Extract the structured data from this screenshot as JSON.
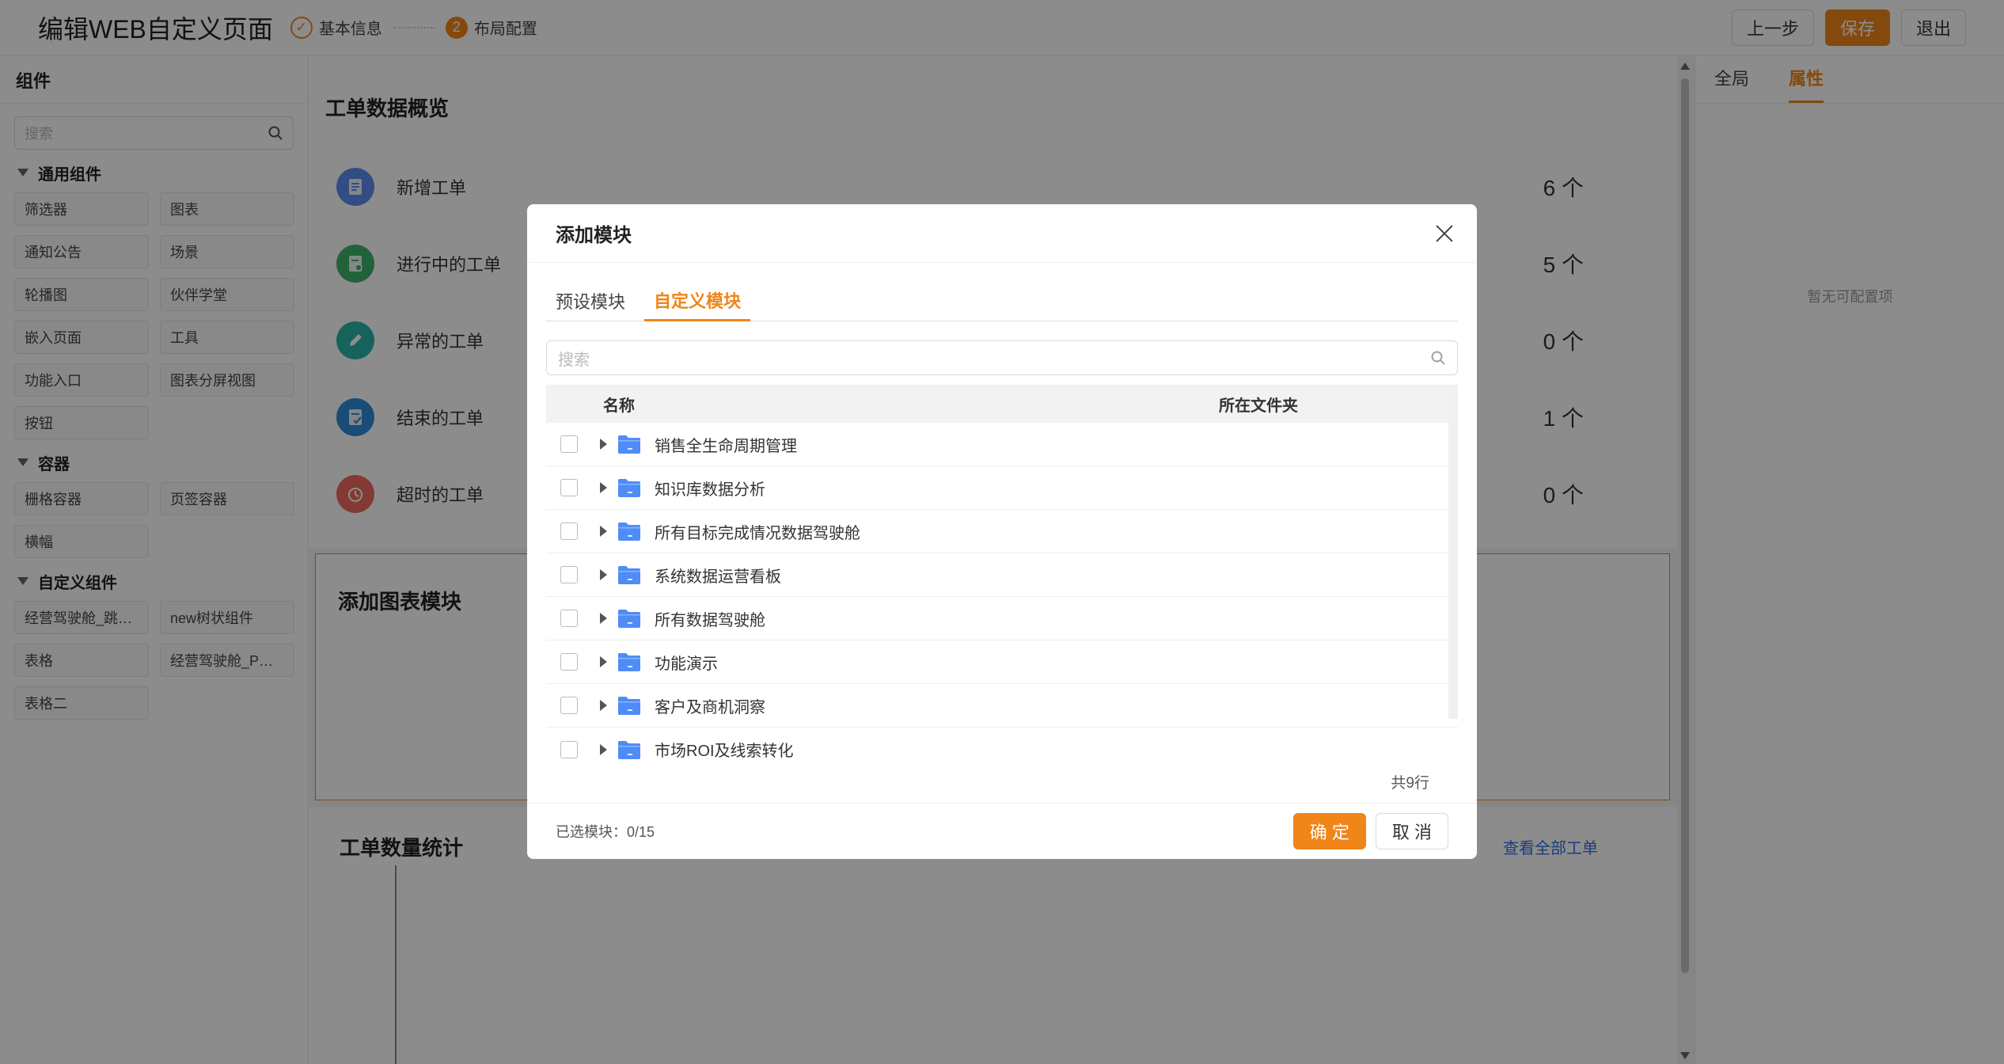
{
  "header": {
    "title": "编辑WEB自定义页面",
    "steps": [
      {
        "label": "基本信息",
        "marker": "✓"
      },
      {
        "label": "布局配置",
        "marker": "2"
      }
    ],
    "buttons": {
      "prev": "上一步",
      "save": "保存",
      "exit": "退出"
    }
  },
  "left_panel": {
    "title": "组件",
    "search_placeholder": "搜索",
    "groups": [
      {
        "title": "通用组件",
        "items": [
          "筛选器",
          "图表",
          "通知公告",
          "场景",
          "轮播图",
          "伙伴学堂",
          "嵌入页面",
          "工具",
          "功能入口",
          "图表分屏视图",
          "按钮"
        ]
      },
      {
        "title": "容器",
        "items": [
          "栅格容器",
          "页签容器",
          "横幅"
        ]
      },
      {
        "title": "自定义组件",
        "items": [
          "经营驾驶舱_跳…",
          "new树状组件",
          "表格",
          "经营驾驶舱_P…",
          "表格二"
        ]
      }
    ]
  },
  "canvas": {
    "overview_title": "工单数据概览",
    "stats": [
      {
        "label": "新增工单",
        "value": "6 个",
        "color": "#5b8def",
        "icon": "document-icon"
      },
      {
        "label": "进行中的工单",
        "value": "5 个",
        "color": "#3fb26b",
        "icon": "list-icon"
      },
      {
        "label": "异常的工单",
        "value": "0 个",
        "color": "#27b4a6",
        "icon": "pencil-icon"
      },
      {
        "label": "结束的工单",
        "value": "1 个",
        "color": "#2f8ad8",
        "icon": "checklist-icon"
      },
      {
        "label": "超时的工单",
        "value": "0 个",
        "color": "#ef6a5f",
        "icon": "alarm-clock-icon"
      }
    ],
    "chart_module_title": "添加图表模块",
    "count_stats_title": "工单数量统计",
    "view_all_link": "查看全部工单"
  },
  "right_panel": {
    "tabs": [
      "全局",
      "属性"
    ],
    "active_tab": "属性",
    "empty_text": "暂无可配置项"
  },
  "modal": {
    "title": "添加模块",
    "tabs": [
      "预设模块",
      "自定义模块"
    ],
    "active_tab": "自定义模块",
    "search_placeholder": "搜索",
    "columns": {
      "name": "名称",
      "folder": "所在文件夹"
    },
    "rows": [
      "销售全生命周期管理",
      "知识库数据分析",
      "所有目标完成情况数据驾驶舱",
      "系统数据运营看板",
      "所有数据驾驶舱",
      "功能演示",
      "客户及商机洞察",
      "市场ROI及线索转化"
    ],
    "row_count": "共9行",
    "selected": "已选模块：0/15",
    "ok": "确 定",
    "cancel": "取 消"
  },
  "colors": {
    "accent": "#f08519",
    "folder": "#4e8cf7",
    "link": "#2f6fe0"
  }
}
